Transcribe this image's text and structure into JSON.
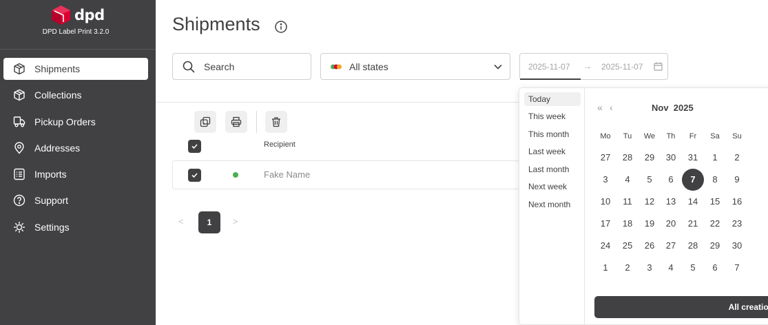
{
  "app": {
    "brand": "dpd",
    "version": "DPD Label Print 3.2.0"
  },
  "sidebar": {
    "items": [
      {
        "label": "Shipments",
        "icon": "box-icon",
        "active": true
      },
      {
        "label": "Collections",
        "icon": "box-icon"
      },
      {
        "label": "Pickup Orders",
        "icon": "truck-icon"
      },
      {
        "label": "Addresses",
        "icon": "location-pin-icon"
      },
      {
        "label": "Imports",
        "icon": "list-icon"
      },
      {
        "label": "Support",
        "icon": "help-circle-icon"
      },
      {
        "label": "Settings",
        "icon": "gear-icon"
      }
    ]
  },
  "main": {
    "title": "Shipments",
    "search": {
      "placeholder": "Search"
    },
    "state_filter": {
      "value": "All states"
    },
    "date_range": {
      "from": "2025-11-07",
      "separator": "→",
      "to": "2025-11-07"
    },
    "table": {
      "columns": [
        "Recipient"
      ],
      "rows": [
        {
          "recipient": "Fake Name",
          "status_color": "#4caf50"
        }
      ]
    },
    "pagination": {
      "prev": "<",
      "current": "1",
      "next": ">"
    }
  },
  "datepicker": {
    "presets": [
      "Today",
      "This week",
      "This month",
      "Last week",
      "Last month",
      "Next week",
      "Next month"
    ],
    "active_preset": "Today",
    "nav_prev_year": "«",
    "nav_prev_month": "‹",
    "month": "Nov",
    "year": "2025",
    "weekdays": [
      "Mo",
      "Tu",
      "We",
      "Th",
      "Fr",
      "Sa",
      "Su"
    ],
    "weeks": [
      [
        "27",
        "28",
        "29",
        "30",
        "31",
        "1",
        "2"
      ],
      [
        "3",
        "4",
        "5",
        "6",
        "7",
        "8",
        "9"
      ],
      [
        "10",
        "11",
        "12",
        "13",
        "14",
        "15",
        "16"
      ],
      [
        "17",
        "18",
        "19",
        "20",
        "21",
        "22",
        "23"
      ],
      [
        "24",
        "25",
        "26",
        "27",
        "28",
        "29",
        "30"
      ],
      [
        "1",
        "2",
        "3",
        "4",
        "5",
        "6",
        "7"
      ]
    ],
    "selected_day": "7",
    "apply_label": "All creation"
  },
  "colors": {
    "sidebar_bg": "#414042",
    "brand_red": "#dc0032",
    "status_green": "#4caf50"
  }
}
